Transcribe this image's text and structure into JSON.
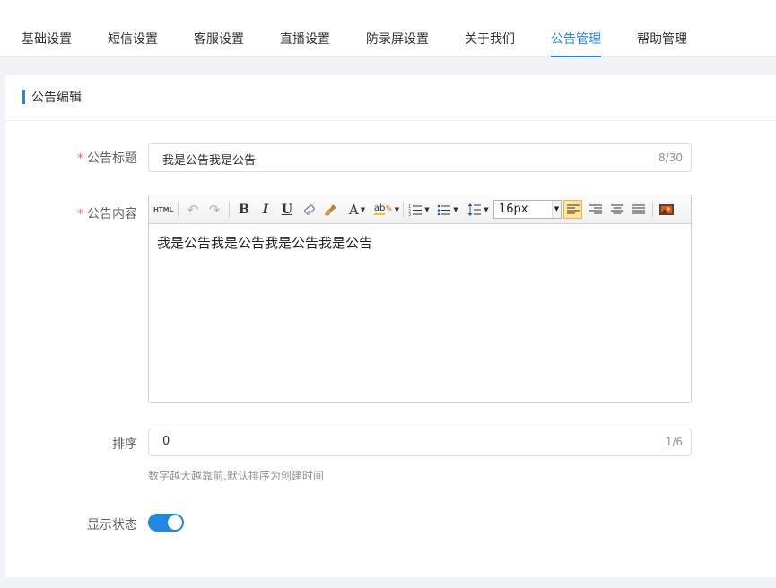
{
  "tabs": [
    {
      "label": "基础设置",
      "active": false
    },
    {
      "label": "短信设置",
      "active": false
    },
    {
      "label": "客服设置",
      "active": false
    },
    {
      "label": "直播设置",
      "active": false
    },
    {
      "label": "防录屏设置",
      "active": false
    },
    {
      "label": "关于我们",
      "active": false
    },
    {
      "label": "公告管理",
      "active": true
    },
    {
      "label": "帮助管理",
      "active": false
    }
  ],
  "section_title": "公告编辑",
  "form": {
    "title_label": "公告标题",
    "title_value": "我是公告我是公告",
    "title_count": "8/30",
    "content_label": "公告内容",
    "content_value": "我是公告我是公告我是公告我是公告",
    "sort_label": "排序",
    "sort_value": "0",
    "sort_count": "1/6",
    "sort_hint": "数字越大越靠前,默认排序为创建时间",
    "status_label": "显示状态",
    "status_on": true
  },
  "editor": {
    "html_label": "HTML",
    "font_size": "16px",
    "icons": [
      "html-icon",
      "undo-icon",
      "redo-icon",
      "bold-icon",
      "italic-icon",
      "underline-icon",
      "eraser-icon",
      "format-brush-icon",
      "font-color-icon",
      "highlight-icon",
      "ordered-list-icon",
      "unordered-list-icon",
      "line-height-icon",
      "align-left-icon",
      "align-right-icon",
      "align-center-icon",
      "align-justify-icon",
      "image-icon"
    ]
  },
  "colors": {
    "accent": "#1e88e5",
    "required": "#f56c6c",
    "active_align_bg": "#ffe69a"
  }
}
